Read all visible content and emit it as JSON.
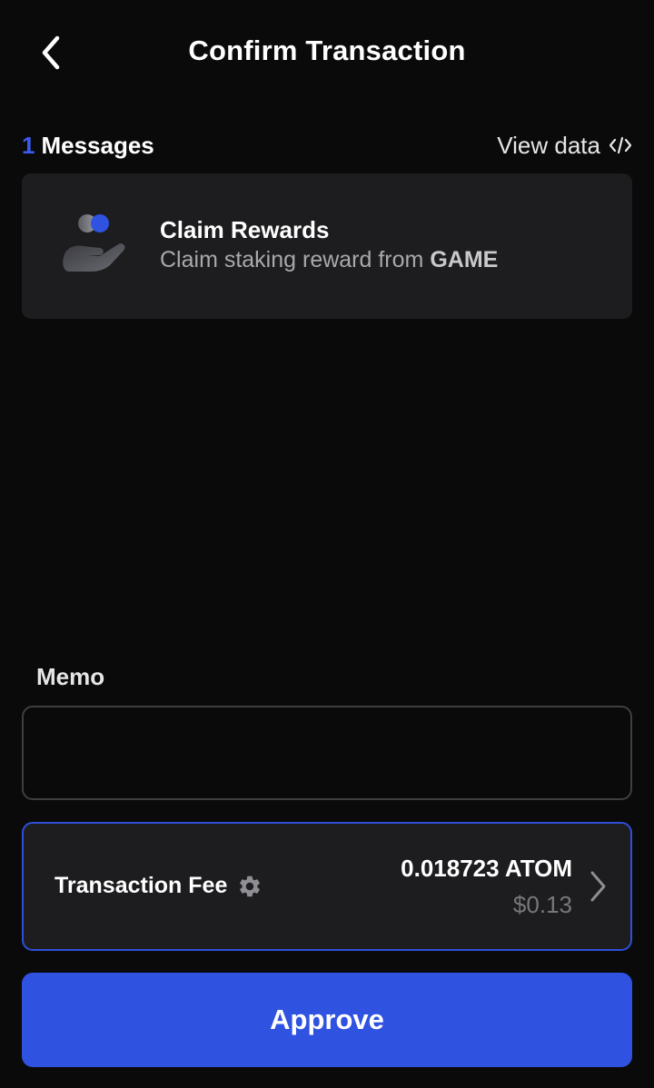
{
  "header": {
    "title": "Confirm Transaction",
    "back_icon": "chevron-left-icon"
  },
  "messages": {
    "count": "1",
    "label": "Messages",
    "view_data_label": "View data",
    "view_data_icon": "code-icon",
    "items": [
      {
        "icon": "claim-rewards-icon",
        "title": "Claim Rewards",
        "description_prefix": "Claim staking reward from",
        "validator": "GAME"
      }
    ]
  },
  "memo": {
    "label": "Memo",
    "value": "",
    "placeholder": ""
  },
  "fee": {
    "label": "Transaction Fee",
    "settings_icon": "gear-icon",
    "amount": "0.018723 ATOM",
    "usd_value": "$0.13",
    "chevron_icon": "chevron-right-icon"
  },
  "actions": {
    "approve_label": "Approve"
  },
  "colors": {
    "background": "#0a0a0a",
    "card": "#1d1d1f",
    "accent": "#2f52e0",
    "count_blue": "#3b5bf0",
    "muted_text": "#a8a8ad"
  }
}
